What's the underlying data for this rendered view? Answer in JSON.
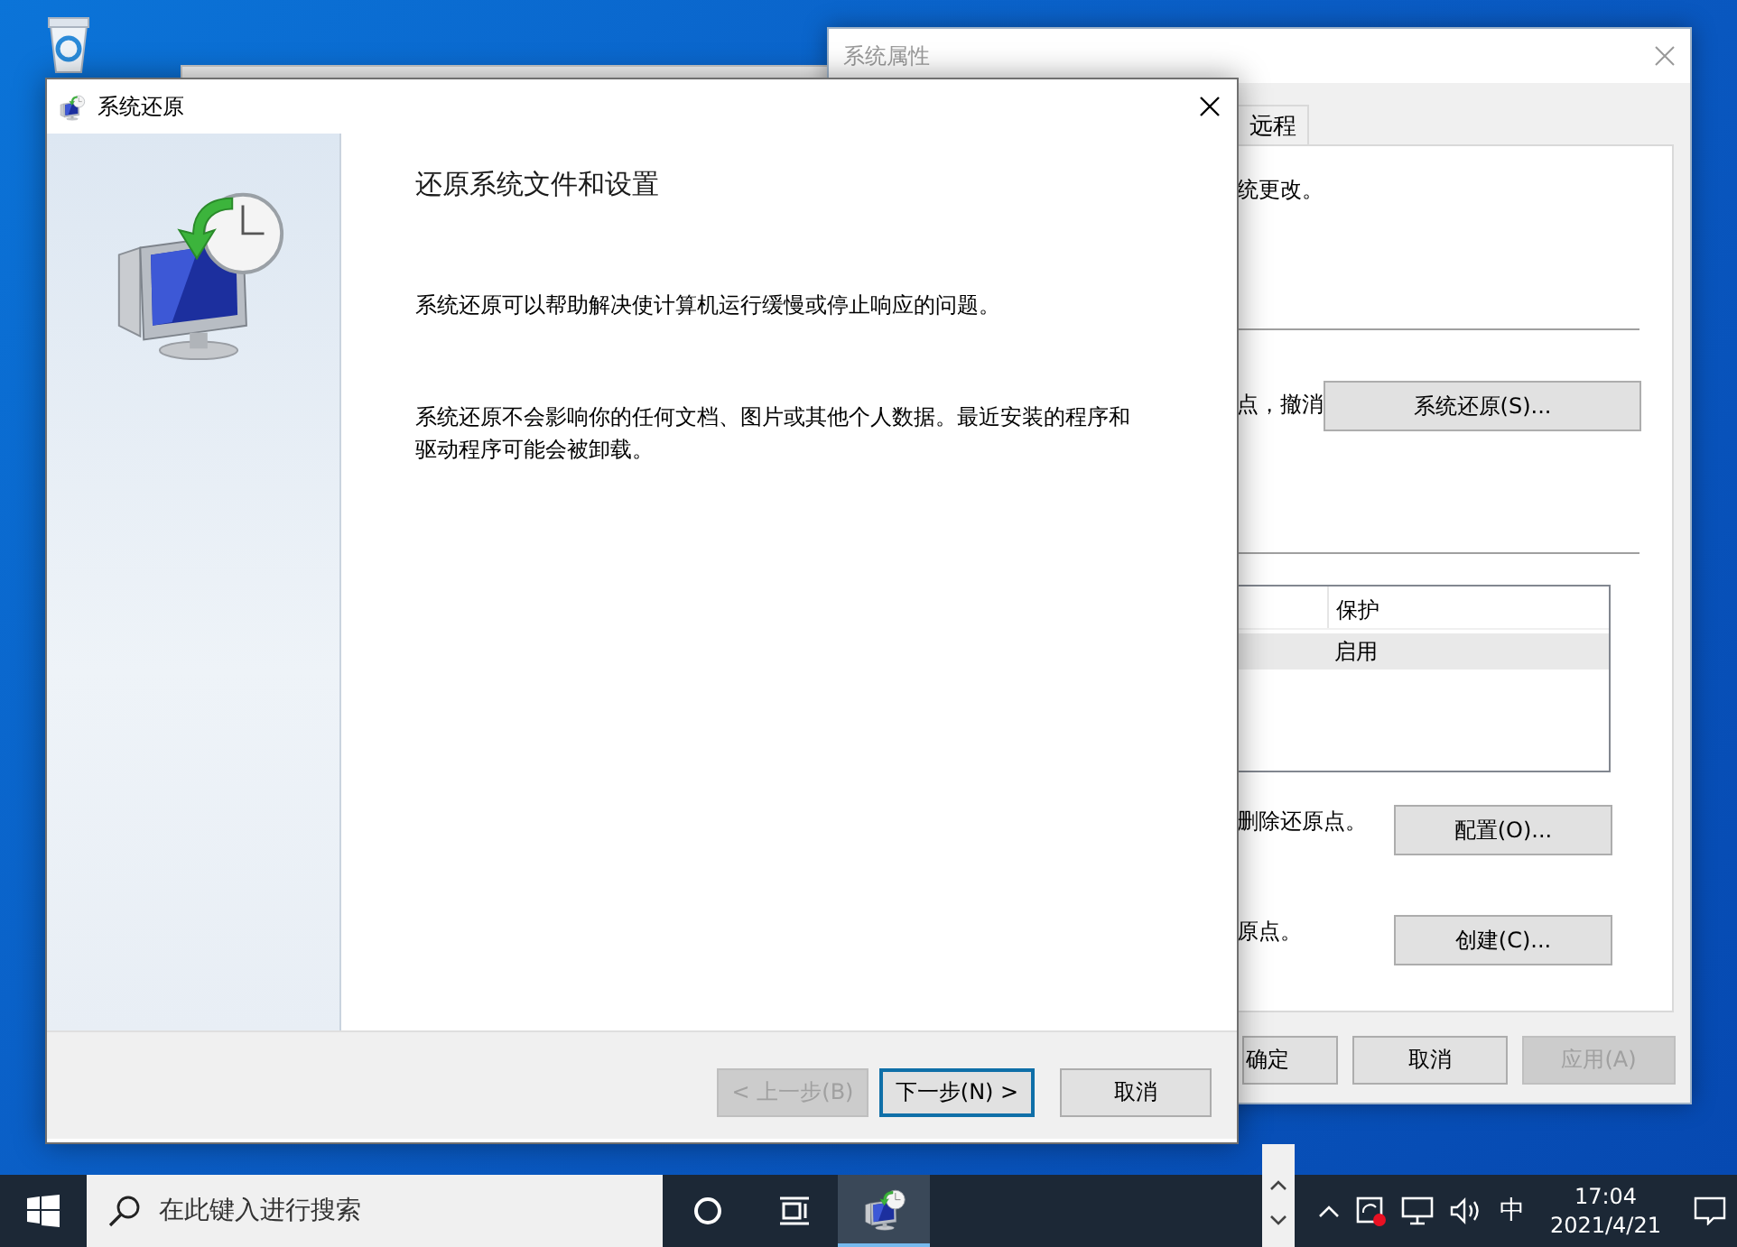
{
  "background_window": {
    "title": "系统属性",
    "tab": {
      "label": "远程",
      "selected": false
    },
    "intro_text": "统更改。",
    "restore_text": "点，撤消",
    "restore_button": "系统还原(S)...",
    "drive_list": {
      "columns": [
        "保护"
      ],
      "rows": [
        {
          "cells": [
            "启用"
          ],
          "selected": true
        }
      ]
    },
    "config_text": "删除还原点。",
    "config_button": "配置(O)...",
    "create_text": "原点。",
    "create_button": "创建(C)...",
    "buttons": [
      {
        "label": "确定",
        "disabled": false
      },
      {
        "label": "取消",
        "disabled": false
      },
      {
        "label": "应用(A)",
        "disabled": true
      }
    ]
  },
  "dialog": {
    "title": "系统还原",
    "heading": "还原系统文件和设置",
    "paragraphs": [
      "系统还原可以帮助解决使计算机运行缓慢或停止响应的问题。",
      "系统还原不会影响你的任何文档、图片或其他个人数据。最近安装的程序和驱动程序可能会被卸载。"
    ],
    "buttons": [
      {
        "label": "< 上一步(B)",
        "disabled": true,
        "focused": false
      },
      {
        "label": "下一步(N) >",
        "disabled": false,
        "focused": true
      },
      {
        "label": "取消",
        "disabled": false,
        "focused": false
      }
    ]
  },
  "taskbar": {
    "search": {
      "placeholder": "在此键入进行搜索"
    },
    "ime": "中",
    "time": "17:04",
    "date": "2021/4/21"
  }
}
